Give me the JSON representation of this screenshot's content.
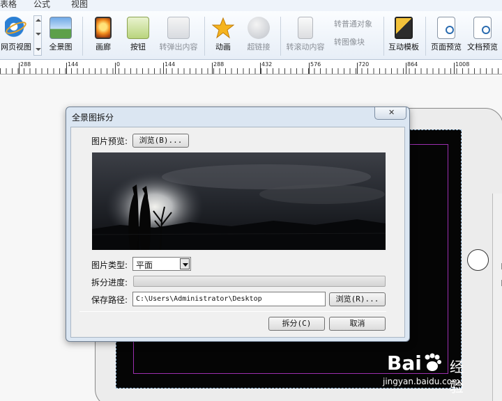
{
  "menu": {
    "tabs": [
      "表格",
      "公式",
      "视图"
    ]
  },
  "ribbon": {
    "buttons": [
      {
        "label": "网页视图",
        "icon": "ie-icon",
        "disabled": false
      },
      {
        "label": "全景图",
        "icon": "panorama-icon",
        "disabled": false
      },
      {
        "label": "画廊",
        "icon": "gallery-icon",
        "disabled": false
      },
      {
        "label": "按钮",
        "icon": "button-icon",
        "disabled": false
      },
      {
        "label": "转弹出内容",
        "icon": "popup-icon",
        "disabled": true
      },
      {
        "label": "动画",
        "icon": "animation-star-icon",
        "disabled": false
      },
      {
        "label": "超链接",
        "icon": "hyperlink-icon",
        "disabled": true
      },
      {
        "label": "转滚动内容",
        "icon": "scroll-content-icon",
        "disabled": true
      },
      {
        "label": "互动模板",
        "icon": "template-icon",
        "disabled": false
      },
      {
        "label": "页面预览",
        "icon": "page-preview-icon",
        "disabled": false
      },
      {
        "label": "文档预览",
        "icon": "doc-preview-icon",
        "disabled": false
      }
    ],
    "small_commands": [
      "转普通对象",
      "转图像块"
    ]
  },
  "ruler": {
    "labels": [
      "288",
      "144",
      "0",
      "144",
      "288",
      "432",
      "576",
      "720",
      "864",
      "1008"
    ]
  },
  "dialog": {
    "title": "全景图拆分",
    "close_symbol": "✕",
    "preview_label": "图片预览:",
    "browse1_label": "浏览(B)...",
    "type_label": "图片类型:",
    "type_value": "平面",
    "progress_label": "拆分进度:",
    "progress": 0,
    "path_label": "保存路径:",
    "path_value": "C:\\Users\\Administrator\\Desktop",
    "browse2_label": "浏览(R)...",
    "split_label": "拆分(C)",
    "cancel_label": "取消"
  },
  "watermark": {
    "brand": "Bai",
    "brand2": "经验",
    "url": "jingyan.baidu.com"
  },
  "colors": {
    "frame_border": "#9c2fb0",
    "selection_dash": "#8fb5d6",
    "accent": "#2b6cb0"
  }
}
